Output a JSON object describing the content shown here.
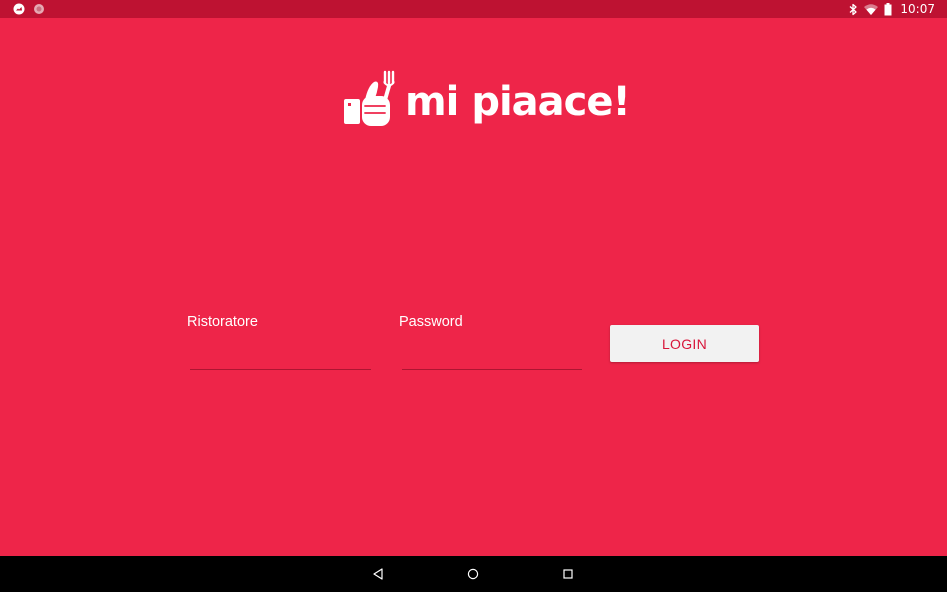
{
  "status_bar": {
    "time": "10:07",
    "icons": [
      "notification-icon",
      "notification-dot-icon",
      "bluetooth-icon",
      "wifi-icon",
      "battery-icon"
    ]
  },
  "logo": {
    "text": "mi piaace!",
    "icon": "thumbs-up-fork-icon"
  },
  "login_form": {
    "username": {
      "label": "Ristoratore",
      "value": "",
      "placeholder": ""
    },
    "password": {
      "label": "Password",
      "value": "",
      "placeholder": ""
    },
    "login_button_label": "LOGIN"
  },
  "navigation_bar": {
    "icons": [
      "back-icon",
      "home-icon",
      "recents-icon"
    ]
  },
  "colors": {
    "background": "#ee2549",
    "status_bar": "#be1232",
    "button_background": "#f2f2f2",
    "button_text": "#d8163a",
    "nav_bar": "#000000"
  }
}
